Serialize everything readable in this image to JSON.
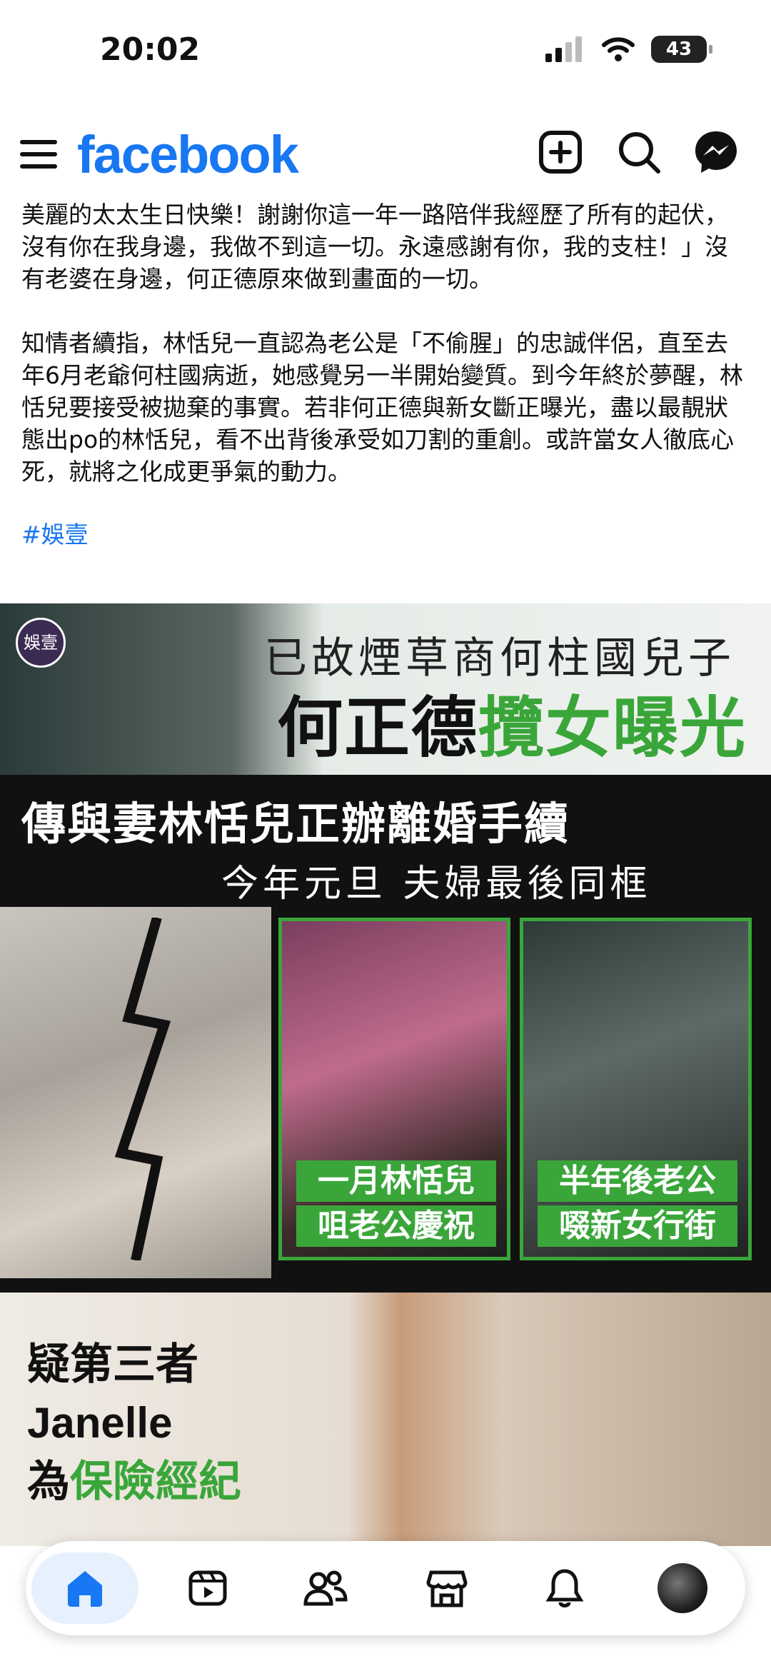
{
  "status_bar": {
    "time": "20:02",
    "battery": "43"
  },
  "header": {
    "logo": "facebook"
  },
  "post": {
    "para1": "美麗的太太生日快樂！謝謝你這一年一路陪伴我經歷了所有的起伏，沒有你在我身邊，我做不到這一切。永遠感謝有你，我的支柱！」沒有老婆在身邊，何正德原來做到畫面的一切。",
    "para2": "知情者續指，林恬兒一直認為老公是「不偷腥」的忠誠伴侶，直至去年6月老爺何柱國病逝，她感覺另一半開始變質。到今年終於夢醒，林恬兒要接受被拋棄的事實。若非何正德與新女斷正曝光，盡以最靚狀態出po的林恬兒，看不出背後承受如刀割的重創。或許當女人徹底心死，就將之化成更爭氣的動力。",
    "hashtag": "#娛壹"
  },
  "image": {
    "logo_text": "娛壹",
    "top_line1": "已故煙草商何柱國兒子",
    "top_line2a": "何正德",
    "top_line2b": "攬女曝光",
    "mid_line1": "傳與妻林恬兒正辦離婚手續",
    "mid_line2": "今年元旦 夫婦最後同框",
    "caption1_a": "一月林恬兒",
    "caption1_b": "咀老公慶祝",
    "caption2_a": "半年後老公",
    "caption2_b": "啜新女行街",
    "bottom_line1": "疑第三者",
    "bottom_line2": "Janelle",
    "bottom_line3a": "為",
    "bottom_line3b": "保險經紀"
  },
  "bottom_nav": {
    "items": [
      "home",
      "video",
      "friends",
      "marketplace",
      "notifications",
      "profile"
    ]
  },
  "colors": {
    "brand": "#1877f2",
    "accent_green": "#3aa63a"
  }
}
